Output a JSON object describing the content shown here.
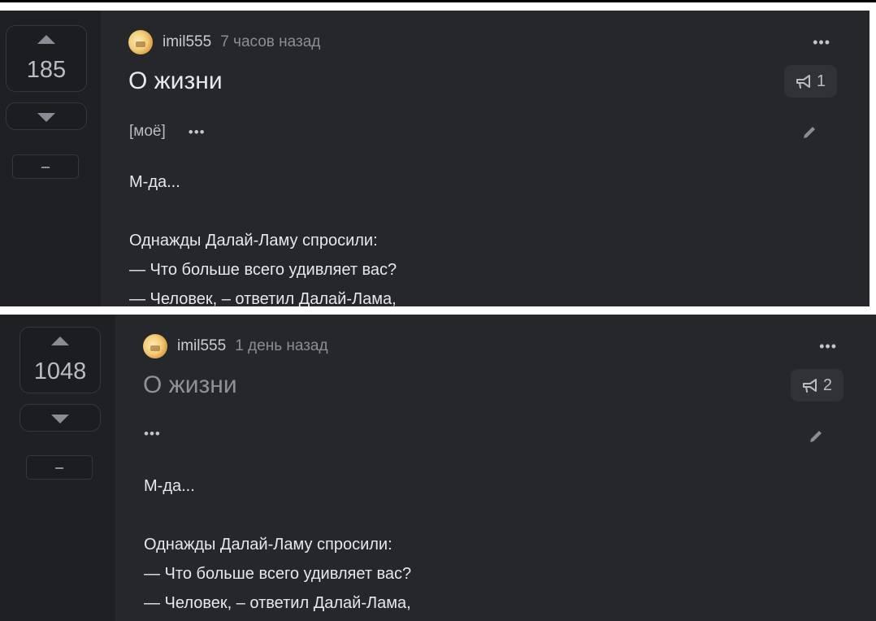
{
  "posts": [
    {
      "score": "185",
      "author": "imil555",
      "time": "7 часов назад",
      "title": "О жизни",
      "comments": "1",
      "tag": "[моё]",
      "body": [
        "М-да...",
        "",
        "Однажды Далай-Ламу спросили:",
        "— Что больше всего удивляет вас?",
        "— Человек, – ответил Далай-Лама,"
      ]
    },
    {
      "score": "1048",
      "author": "imil555",
      "time": "1 день назад",
      "title": "О жизни",
      "comments": "2",
      "tag": "",
      "body": [
        "М-да...",
        "",
        "Однажды Далай-Ламу спросили:",
        "— Что больше всего удивляет вас?",
        "— Человек, – ответил Далай-Лама,"
      ]
    }
  ],
  "icons": {
    "upvote": "arrow-up-icon",
    "downvote": "arrow-down-icon",
    "comments": "megaphone-icon",
    "edit": "pencil-icon",
    "more": "more-dots-icon"
  },
  "colors": {
    "background": "#1f2023",
    "card": "#25272b",
    "text": "#e6e8eb",
    "muted": "#8b8e94"
  }
}
